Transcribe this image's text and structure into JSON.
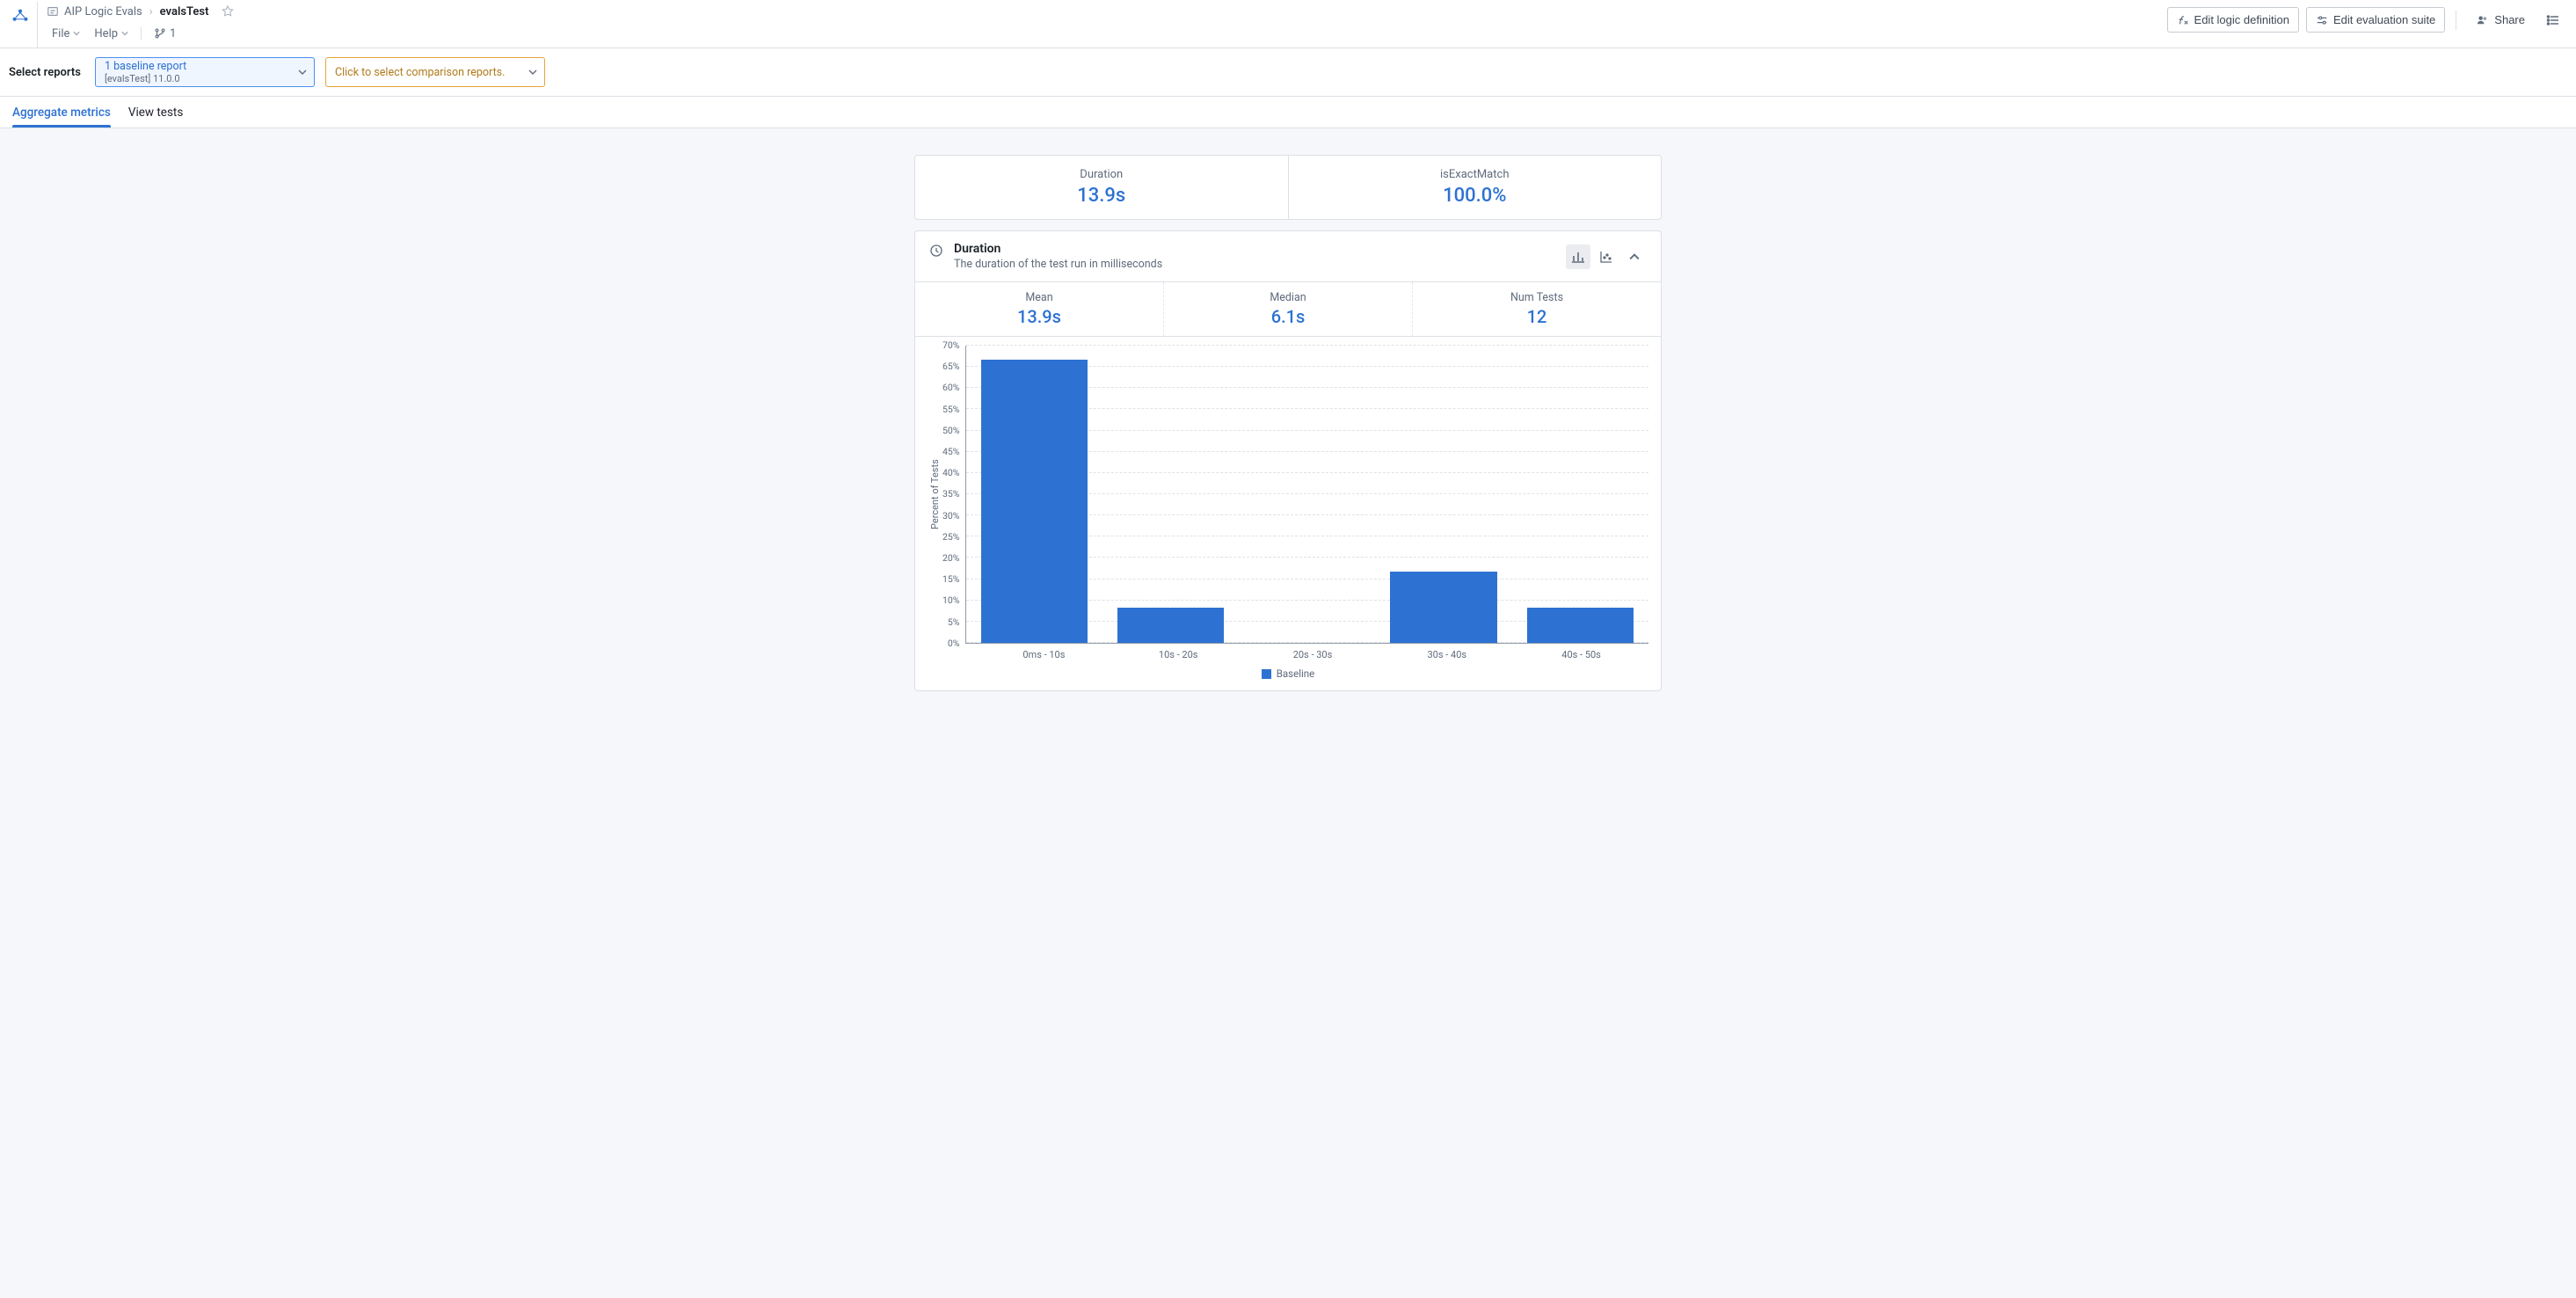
{
  "header": {
    "breadcrumbs": {
      "root": "AIP Logic Evals",
      "current": "evalsTest"
    },
    "menus": {
      "file": "File",
      "help": "Help",
      "branch_count": "1"
    },
    "actions": {
      "edit_logic": "Edit logic definition",
      "edit_suite": "Edit evaluation suite",
      "share": "Share"
    }
  },
  "selector": {
    "label": "Select reports",
    "baseline": {
      "line1": "1 baseline report",
      "line2": "[evalsTest] 11.0.0"
    },
    "comparison": {
      "line1": "Click to select comparison reports."
    }
  },
  "tabs": {
    "aggregate": "Aggregate metrics",
    "viewtests": "View tests"
  },
  "summary": {
    "duration_label": "Duration",
    "duration_value": "13.9s",
    "match_label": "isExactMatch",
    "match_value": "100.0%"
  },
  "duration_section": {
    "title": "Duration",
    "subtitle": "The duration of the test run in milliseconds",
    "stats": {
      "mean_label": "Mean",
      "mean_value": "13.9s",
      "median_label": "Median",
      "median_value": "6.1s",
      "numtests_label": "Num Tests",
      "numtests_value": "12"
    }
  },
  "chart_data": {
    "type": "bar",
    "ylabel": "Percent of Tests",
    "ylim": [
      0,
      70
    ],
    "y_ticks": [
      "70%",
      "65%",
      "60%",
      "55%",
      "50%",
      "45%",
      "40%",
      "35%",
      "30%",
      "25%",
      "20%",
      "15%",
      "10%",
      "5%",
      "0%"
    ],
    "categories": [
      "0ms - 10s",
      "10s - 20s",
      "20s - 30s",
      "30s - 40s",
      "40s - 50s"
    ],
    "series": [
      {
        "name": "Baseline",
        "color": "#2d72d2",
        "values": [
          66.7,
          8.3,
          0,
          16.7,
          8.3
        ]
      }
    ]
  }
}
